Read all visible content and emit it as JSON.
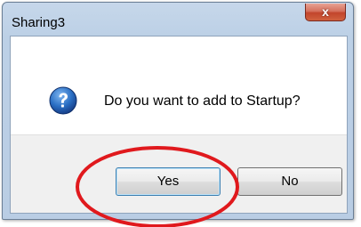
{
  "window": {
    "title": "Sharing3",
    "close_glyph": "x"
  },
  "dialog": {
    "icon": "question-icon",
    "message": "Do you want to add to Startup?"
  },
  "buttons": {
    "yes_label": "Yes",
    "no_label": "No"
  },
  "annotation": {
    "shape": "ellipse",
    "color": "#e0191d",
    "target": "yes-button"
  },
  "colors": {
    "titlebar": "#bcd0e6",
    "close_button": "#c2452c",
    "icon_blue": "#1f63b8"
  }
}
